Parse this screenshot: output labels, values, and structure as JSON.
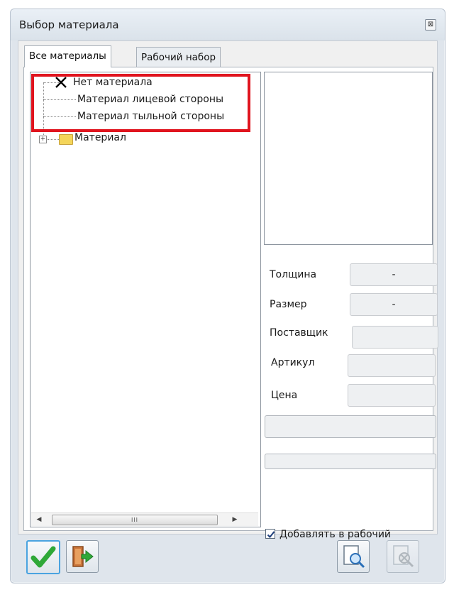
{
  "window": {
    "title": "Выбор материала",
    "close_glyph": "⊠"
  },
  "tabs": [
    {
      "label": "Все материалы",
      "active": true
    },
    {
      "label": "Рабочий набор",
      "active": false
    }
  ],
  "tree": {
    "items": [
      {
        "label": "Нет материала",
        "icon": "x-icon"
      },
      {
        "label": "Материал лицевой стороны",
        "icon": ""
      },
      {
        "label": "Материал тыльной стороны",
        "icon": ""
      },
      {
        "label": "Материал",
        "icon": "folder-icon",
        "expander": "+"
      }
    ],
    "scroll_thumb_grip": "III",
    "scroll_left": "◀",
    "scroll_right": "▶"
  },
  "properties": {
    "thickness_label": "Толщина",
    "thickness_value": "-",
    "size_label": "Размер",
    "size_value": "-",
    "supplier_label": "Поставщик",
    "supplier_value": "",
    "article_label": "Артикул",
    "article_value": "",
    "price_label": "Цена",
    "price_value": ""
  },
  "add_to_workset": {
    "label": "Добавлять в рабочий",
    "checked": true,
    "check_glyph": "✓"
  },
  "colors": {
    "highlight": "#e0141e",
    "ok_green": "#2fa838",
    "folder_yellow": "#f4d55a"
  }
}
